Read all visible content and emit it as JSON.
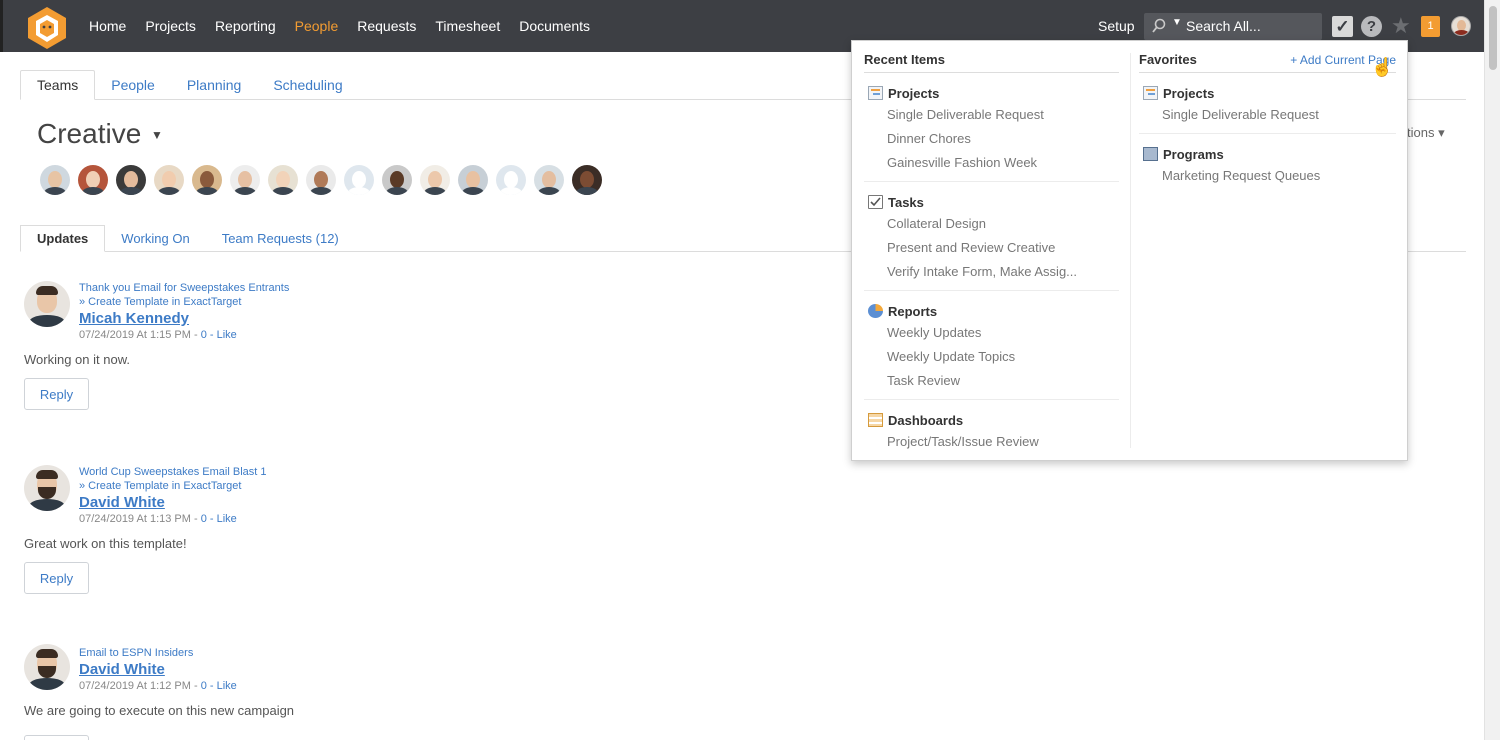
{
  "nav": {
    "items": [
      {
        "label": "Home"
      },
      {
        "label": "Projects"
      },
      {
        "label": "Reporting"
      },
      {
        "label": "People"
      },
      {
        "label": "Requests"
      },
      {
        "label": "Timesheet"
      },
      {
        "label": "Documents"
      }
    ],
    "active": "People",
    "setup_label": "Setup",
    "search_placeholder": "Search All...",
    "notification_count": "1",
    "accent_color": "#f39c32"
  },
  "tabs": [
    {
      "label": "Teams"
    },
    {
      "label": "People"
    },
    {
      "label": "Planning"
    },
    {
      "label": "Scheduling"
    }
  ],
  "team": {
    "title": "Creative",
    "options_fragment": "tions",
    "members": [
      {
        "skin": "#e7c4a4",
        "bg": "#cfd8df"
      },
      {
        "skin": "#f0cfb5",
        "bg": "#b5553b"
      },
      {
        "skin": "#e3bb9c",
        "bg": "#3a3a3a"
      },
      {
        "skin": "#f1ccae",
        "bg": "#e8d9c5"
      },
      {
        "skin": "#8a5a3c",
        "bg": "#d9b98e"
      },
      {
        "skin": "#e6c0a3",
        "bg": "#ededed"
      },
      {
        "skin": "#f2d3b9",
        "bg": "#e7e1d3"
      },
      {
        "skin": "#b07a58",
        "bg": "#eaeaea"
      },
      {
        "skin": "#ffffff",
        "bg": "#dfe7ee",
        "blank": true
      },
      {
        "skin": "#5a3a26",
        "bg": "#c9c9c9"
      },
      {
        "skin": "#ecc8ab",
        "bg": "#f1ede6"
      },
      {
        "skin": "#e8c1a1",
        "bg": "#c7cfd6"
      },
      {
        "skin": "#ffffff",
        "bg": "#dfe7ee",
        "blank": true
      },
      {
        "skin": "#e4bea0",
        "bg": "#d7dfe4"
      },
      {
        "skin": "#7c4c33",
        "bg": "#3b2d26"
      }
    ]
  },
  "subtabs": [
    {
      "label": "Updates"
    },
    {
      "label": "Working On"
    },
    {
      "label": "Team Requests (12)"
    }
  ],
  "feed": [
    {
      "context": "Thank you Email for Sweepstakes Entrants",
      "subcontext": "» Create Template in ExactTarget",
      "author": "Micah Kennedy",
      "date": "07/24/2019 At 1:15 PM - ",
      "likes": "0 - Like",
      "body": "Working on it now.",
      "reply_label": "Reply"
    },
    {
      "context": "World Cup Sweepstakes Email Blast 1",
      "subcontext": "» Create Template in ExactTarget",
      "author": "David White",
      "date": "07/24/2019 At 1:13 PM - ",
      "likes": "0 - Like",
      "body": "Great work on this template!",
      "reply_label": "Reply"
    },
    {
      "context": "Email to ESPN Insiders",
      "author": "David White",
      "date": "07/24/2019 At 1:12 PM - ",
      "likes": "0 - Like",
      "body": "We are going to execute on this new campaign"
    }
  ],
  "dropdown": {
    "recent_heading": "Recent Items",
    "favorites_heading": "Favorites",
    "add_current_page": "+ Add Current Page",
    "recent_groups": [
      {
        "title": "Projects",
        "icon": "project-icon",
        "items": [
          "Single Deliverable Request",
          "Dinner Chores",
          "Gainesville Fashion Week"
        ]
      },
      {
        "title": "Tasks",
        "icon": "task-icon",
        "items": [
          "Collateral Design",
          "Present and Review Creative",
          "Verify Intake Form, Make Assig..."
        ]
      },
      {
        "title": "Reports",
        "icon": "report-icon",
        "items": [
          "Weekly Updates",
          "Weekly Update Topics",
          "Task Review"
        ]
      },
      {
        "title": "Dashboards",
        "icon": "dashboard-icon",
        "items": [
          "Project/Task/Issue Review"
        ]
      }
    ],
    "favorite_groups": [
      {
        "title": "Projects",
        "icon": "project-icon",
        "items": [
          "Single Deliverable Request"
        ]
      },
      {
        "title": "Programs",
        "icon": "program-icon",
        "items": [
          "Marketing Request Queues"
        ]
      }
    ]
  }
}
